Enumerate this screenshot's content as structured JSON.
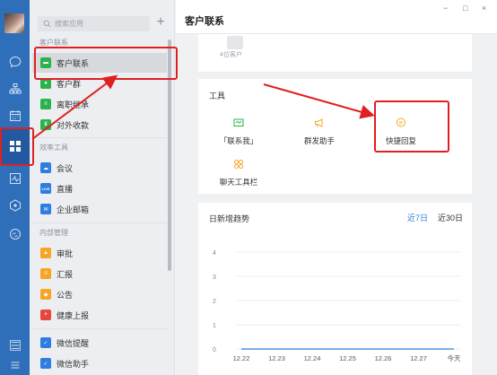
{
  "panel": {
    "search_placeholder": "搜索应用",
    "add_symbol": "+",
    "sections": {
      "customer": "客户联系",
      "efficiency": "效率工具",
      "internal": "内部管理"
    },
    "customer_items": [
      {
        "label": "客户联系",
        "color": "#2bb24c",
        "icon": "chat-bubble-icon"
      },
      {
        "label": "客户群",
        "color": "#2bb24c",
        "icon": "people-icon"
      },
      {
        "label": "离职继承",
        "color": "#2bb24c",
        "icon": "handover-icon"
      },
      {
        "label": "对外收款",
        "color": "#2bb24c",
        "icon": "payment-icon"
      }
    ],
    "efficiency_items": [
      {
        "label": "会议",
        "color": "#2f7de1",
        "icon": "cloud-icon"
      },
      {
        "label": "直播",
        "color": "#2f7de1",
        "icon": "live-icon"
      },
      {
        "label": "企业邮箱",
        "color": "#2f7de1",
        "icon": "mail-icon"
      }
    ],
    "internal_items": [
      {
        "label": "审批",
        "color": "#f5a623",
        "icon": "approval-icon"
      },
      {
        "label": "汇报",
        "color": "#f5a623",
        "icon": "report-icon"
      },
      {
        "label": "公告",
        "color": "#f5a623",
        "icon": "announcement-icon"
      },
      {
        "label": "健康上报",
        "color": "#e8453c",
        "icon": "health-icon"
      }
    ],
    "bottom_items": [
      {
        "label": "微信提醒",
        "color": "#2f7de1",
        "icon": "checkbox-icon"
      },
      {
        "label": "微信助手",
        "color": "#2f7de1",
        "icon": "checkbox-icon"
      }
    ]
  },
  "main": {
    "title": "客户联系",
    "window_controls": [
      "−",
      "□",
      "×"
    ],
    "customer_count": "4位客户",
    "tools_title": "工具",
    "tools": [
      {
        "label": "「联系我」",
        "icon": "contact-me-icon",
        "color": "#2bb24c"
      },
      {
        "label": "群发助手",
        "icon": "megaphone-icon",
        "color": "#f5a623"
      },
      {
        "label": "快捷回复",
        "icon": "quick-reply-icon",
        "color": "#f5a623"
      },
      {
        "label": "聊天工具栏",
        "icon": "toolbar-icon",
        "color": "#f5a623"
      }
    ],
    "trend": {
      "title": "日新增趋势",
      "range_7": "近7日",
      "range_30": "近30日",
      "accent": "#2f7de1"
    }
  },
  "chart_data": {
    "type": "line",
    "title": "日新增趋势",
    "categories": [
      "12.22",
      "12.23",
      "12.24",
      "12.25",
      "12.26",
      "12.27",
      "今天"
    ],
    "series": [
      {
        "values": [
          0,
          0,
          0,
          0,
          0,
          0,
          0
        ]
      }
    ],
    "yticks": [
      0,
      1,
      2,
      3,
      4
    ],
    "ylim": [
      0,
      4
    ],
    "grid": true
  }
}
